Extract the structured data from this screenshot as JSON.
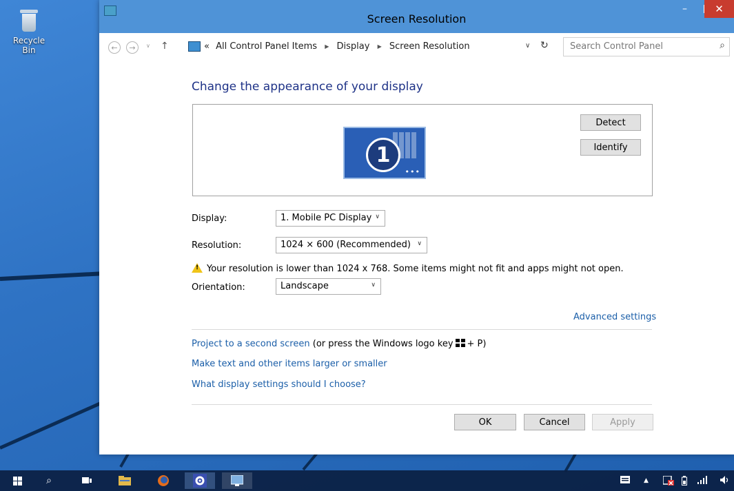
{
  "desktop": {
    "recycle_bin_label": "Recycle Bin"
  },
  "window": {
    "title": "Screen Resolution",
    "minimize_glyph": "–",
    "close_glyph": "✕"
  },
  "address_bar": {
    "back_glyph": "←",
    "forward_glyph": "→",
    "up_glyph": "↑",
    "overflow_glyph": "«",
    "crumbs": [
      "All Control Panel Items",
      "Display",
      "Screen Resolution"
    ],
    "crumb_separator": "▶",
    "dropdown_glyph": "∨",
    "refresh_glyph": "↻",
    "search_placeholder": "Search Control Panel",
    "search_glyph": "⌕"
  },
  "main": {
    "heading": "Change the appearance of your display",
    "monitor_number": "1",
    "detect_label": "Detect",
    "identify_label": "Identify",
    "display_label": "Display:",
    "display_value": "1. Mobile PC Display",
    "resolution_label": "Resolution:",
    "resolution_value": "1024 × 600 (Recommended)",
    "warning_text": "Your resolution is lower than 1024 x 768. Some items might not fit and apps might not open.",
    "orientation_label": "Orientation:",
    "orientation_value": "Landscape",
    "select_arrow": "∨",
    "advanced_settings": "Advanced settings",
    "project_link": "Project to a second screen",
    "project_suffix_before": "(or press the Windows logo key",
    "project_suffix_after": "+ P)",
    "text_size_link": "Make text and other items larger or smaller",
    "help_link": "What display settings should I choose?",
    "ok_label": "OK",
    "cancel_label": "Cancel",
    "apply_label": "Apply"
  },
  "taskbar": {
    "search_glyph": "⌕",
    "tray_up_glyph": "▲"
  },
  "colors": {
    "link": "#1a5ea8",
    "heading": "#1e3287",
    "titlebar": "#4f93d7",
    "close": "#c83c2f",
    "taskbar": "#0b1f42"
  }
}
